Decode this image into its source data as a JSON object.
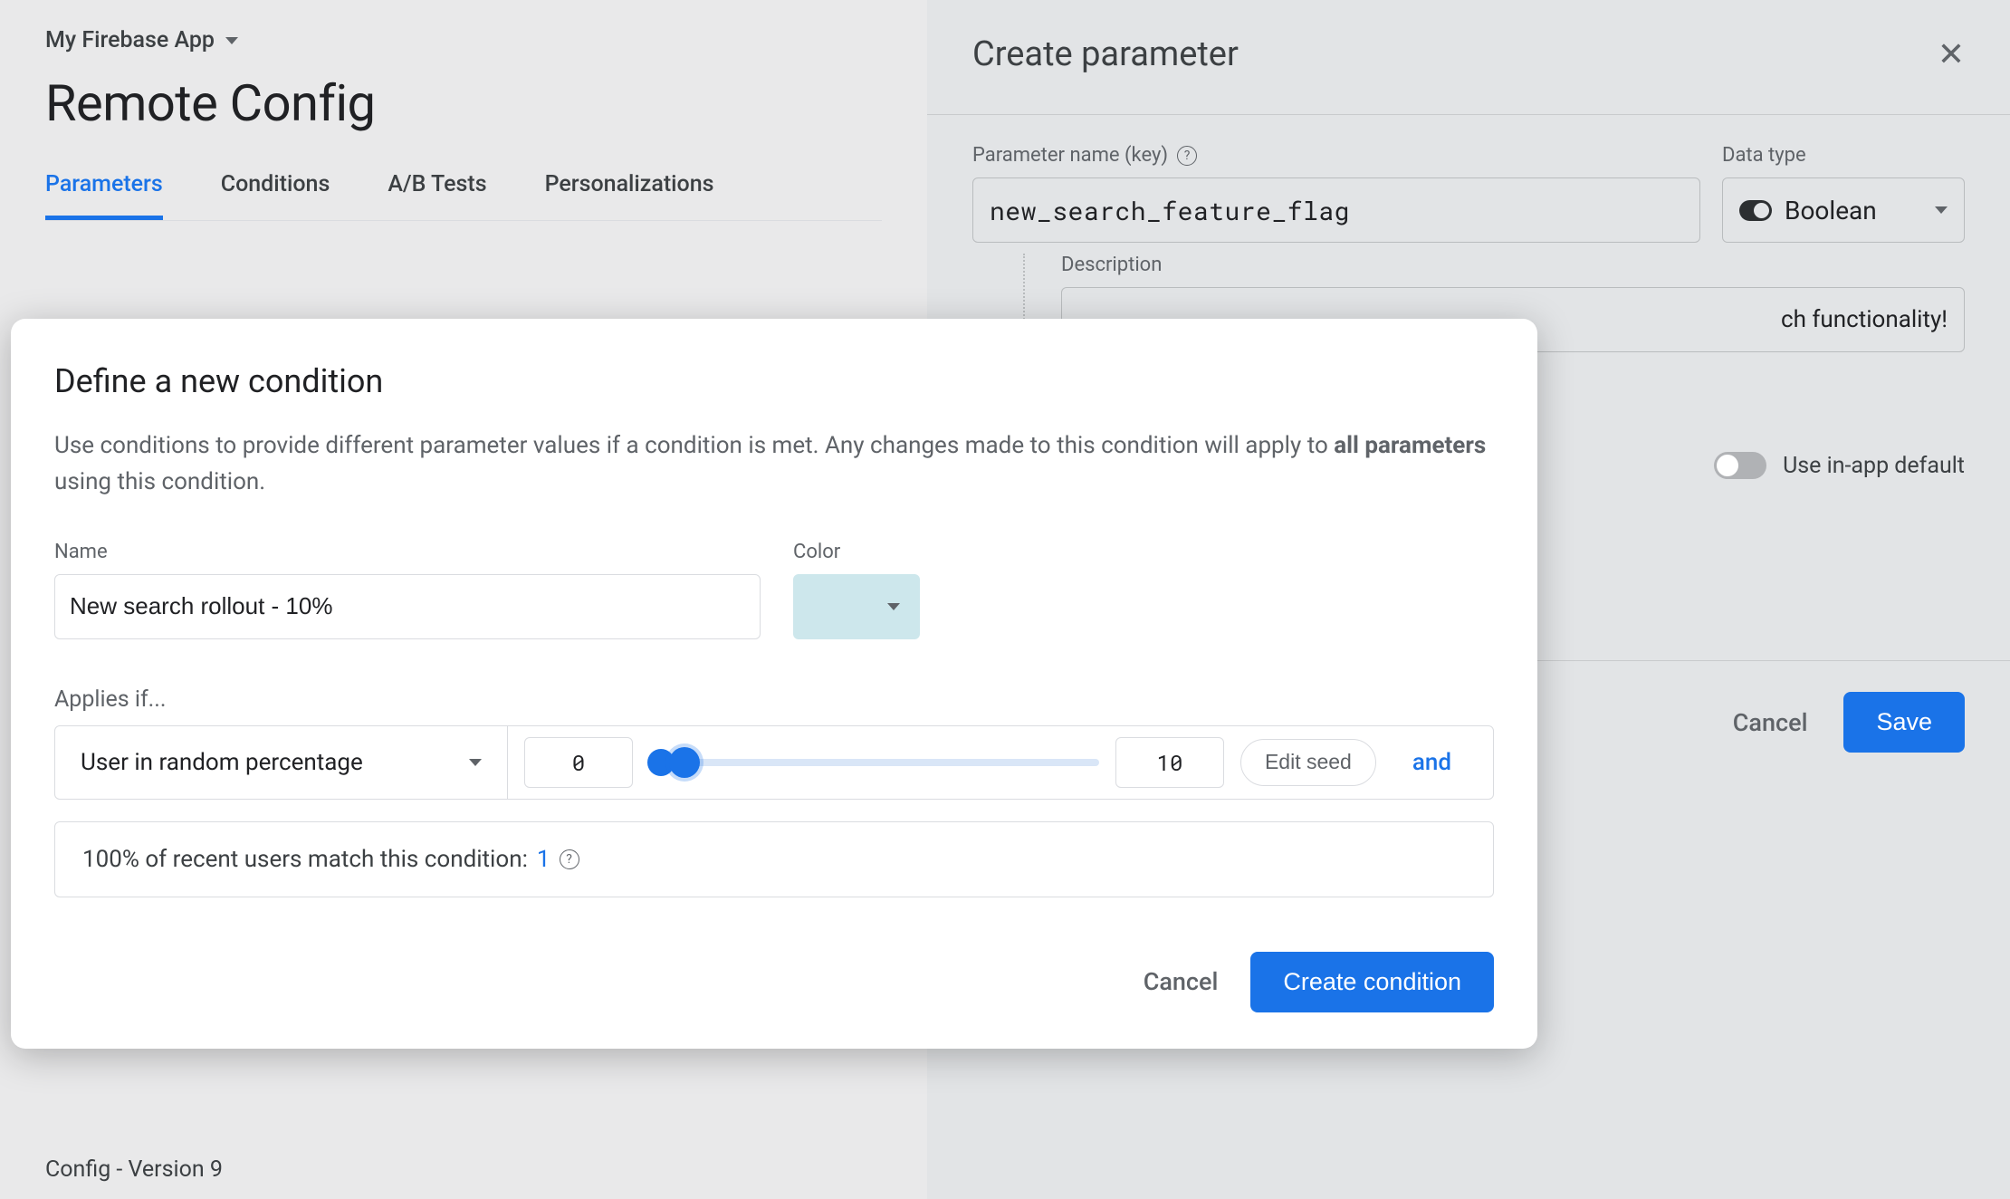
{
  "header": {
    "app_name": "My Firebase App",
    "page_title": "Remote Config"
  },
  "tabs": {
    "items": [
      "Parameters",
      "Conditions",
      "A/B Tests",
      "Personalizations"
    ],
    "active_index": 0
  },
  "footer": {
    "config_version": "Config - Version 9"
  },
  "create_panel": {
    "title": "Create parameter",
    "param_name_label": "Parameter name (key)",
    "param_name_value": "new_search_feature_flag",
    "data_type_label": "Data type",
    "data_type_value": "Boolean",
    "description_label": "Description",
    "description_value_tail": "ch functionality!",
    "use_default_label": "Use in-app default",
    "cancel_label": "Cancel",
    "save_label": "Save"
  },
  "modal": {
    "title": "Define a new condition",
    "desc_part1": "Use conditions to provide different parameter values if a condition is met. Any changes made to this condition will apply to ",
    "desc_strong": "all parameters",
    "desc_part2": " using this condition.",
    "name_label": "Name",
    "name_value": "New search rollout - 10%",
    "color_label": "Color",
    "applies_label": "Applies if...",
    "condition_type": "User in random percentage",
    "range_from": "0",
    "range_to": "10",
    "edit_seed_label": "Edit seed",
    "and_label": "and",
    "match_text": "100% of recent users match this condition: ",
    "match_count": "1",
    "cancel_label": "Cancel",
    "create_label": "Create condition"
  }
}
